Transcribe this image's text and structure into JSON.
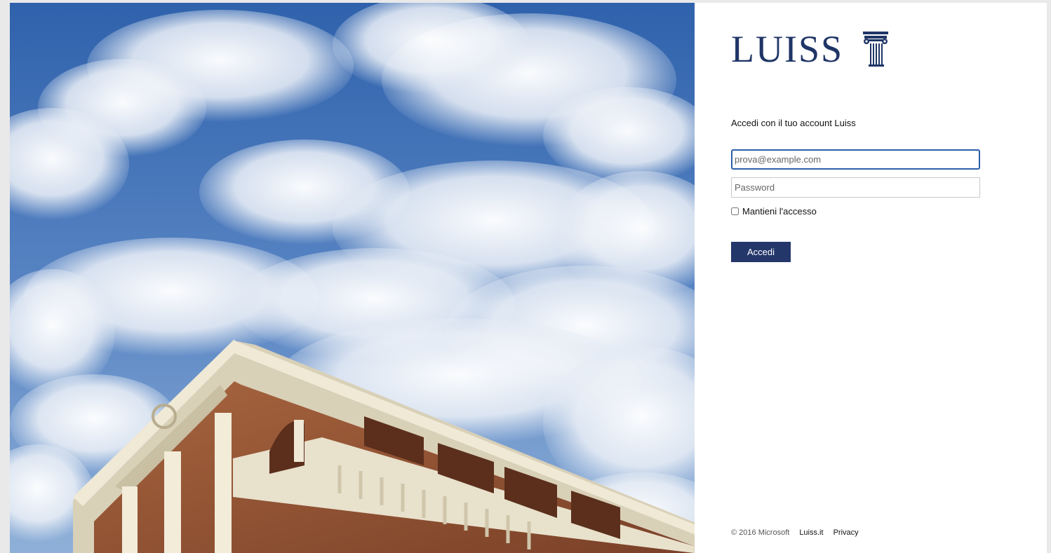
{
  "brand": {
    "logo_text": "LUISS",
    "logo_icon": "column-icon",
    "primary_color": "#24376b",
    "logo_color": "#1f3566"
  },
  "illustration": {
    "subject": "campus-building-under-cloudy-sky",
    "sky_color": "#3f6fb4",
    "brick_color": "#9a5a3c"
  },
  "login": {
    "heading": "Accedi con il tuo account Luiss",
    "email_placeholder": "prova@example.com",
    "password_placeholder": "Password",
    "remember_label": "Mantieni l'accesso",
    "remember_checked": false,
    "submit_label": "Accedi"
  },
  "footer": {
    "copyright": "© 2016 Microsoft",
    "links": [
      "Luiss.it",
      "Privacy"
    ]
  }
}
